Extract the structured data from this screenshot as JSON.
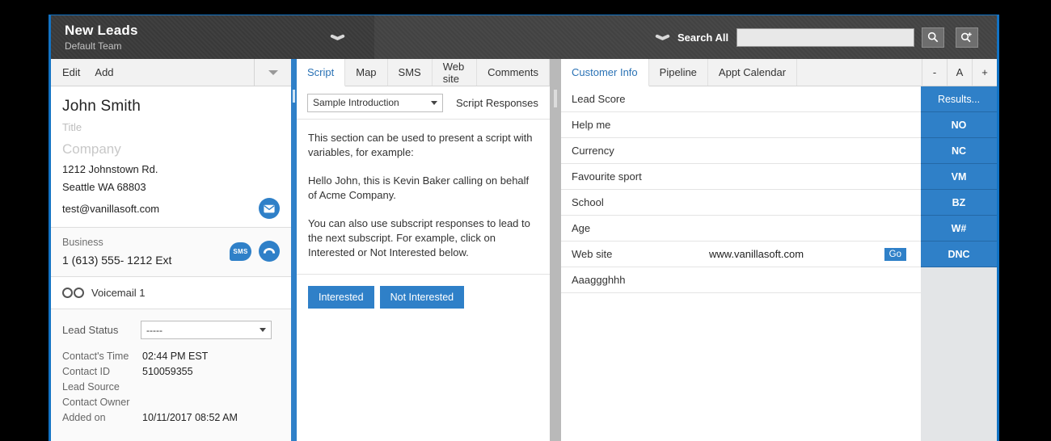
{
  "header": {
    "title": "New Leads",
    "subtitle": "Default Team",
    "collapse_icon": "chevron-down-icon",
    "search_label": "Search All",
    "search_value": "",
    "search_placeholder": "",
    "search_icon": "search-icon",
    "search_add_icon": "search-plus-icon"
  },
  "left_panel": {
    "toolbar": {
      "edit": "Edit",
      "add": "Add",
      "caret_icon": "chevron-down-icon"
    },
    "contact": {
      "name": "John  Smith",
      "title": "Title",
      "company": "Company",
      "address": "1212 Johnstown Rd.",
      "city_state_zip": "Seattle  WA  68803",
      "email": "test@vanillasoft.com",
      "email_icon": "envelope-icon"
    },
    "phone": {
      "label": "Business",
      "number": "1 (613) 555- 1212   Ext",
      "sms_icon": "SMS",
      "call_icon": "phone-icon"
    },
    "voicemail": {
      "icon": "voicemail-icon",
      "label": "Voicemail 1"
    },
    "status": {
      "lead_status_label": "Lead Status",
      "lead_status_value": "-----",
      "meta": [
        {
          "label": "Contact's Time",
          "value": "02:44 PM EST"
        },
        {
          "label": "Contact ID",
          "value": "510059355"
        },
        {
          "label": "Lead Source",
          "value": ""
        },
        {
          "label": "Contact Owner",
          "value": ""
        },
        {
          "label": "Added on",
          "value": "10/11/2017 08:52 AM"
        }
      ]
    }
  },
  "center_panel": {
    "tabs": [
      {
        "label": "Script",
        "active": true
      },
      {
        "label": "Map",
        "active": false
      },
      {
        "label": "SMS",
        "active": false
      },
      {
        "label": "Web site",
        "active": false
      },
      {
        "label": "Comments",
        "active": false
      }
    ],
    "script_select_value": "Sample Introduction",
    "script_responses_label": "Script Responses",
    "paragraphs": [
      "This section can be used to present a script with variables, for example:",
      "Hello John, this is Kevin Baker calling on behalf of Acme Company.",
      "You can also use subscript responses to lead to the next subscript. For example, click on Interested or Not Interested below."
    ],
    "response_buttons": [
      {
        "label": "Interested"
      },
      {
        "label": "Not Interested"
      }
    ]
  },
  "right_panel": {
    "tabs": [
      {
        "label": "Customer Info",
        "active": true
      },
      {
        "label": "Pipeline",
        "active": false
      },
      {
        "label": "Appt Calendar",
        "active": false
      }
    ],
    "zoom_buttons": [
      {
        "label": "-",
        "name": "font-decrease-button"
      },
      {
        "label": "A",
        "name": "font-reset-button"
      },
      {
        "label": "+",
        "name": "font-increase-button"
      }
    ],
    "fields": [
      {
        "label": "Lead Score",
        "value": ""
      },
      {
        "label": "Help me",
        "value": ""
      },
      {
        "label": "Currency",
        "value": ""
      },
      {
        "label": "Favourite sport",
        "value": ""
      },
      {
        "label": "School",
        "value": ""
      },
      {
        "label": "Age",
        "value": ""
      },
      {
        "label": "Web site",
        "value": "www.vanillasoft.com",
        "action": "Go"
      },
      {
        "label": "Aaaggghhh",
        "value": ""
      }
    ],
    "result_buttons": [
      "Results...",
      "NO",
      "NC",
      "VM",
      "BZ",
      "W#",
      "DNC"
    ]
  },
  "colors": {
    "accent_blue": "#2f80c8",
    "frame_blue": "#1273c4",
    "header_dark": "#444444",
    "title_dark": "#3b3b3b"
  }
}
